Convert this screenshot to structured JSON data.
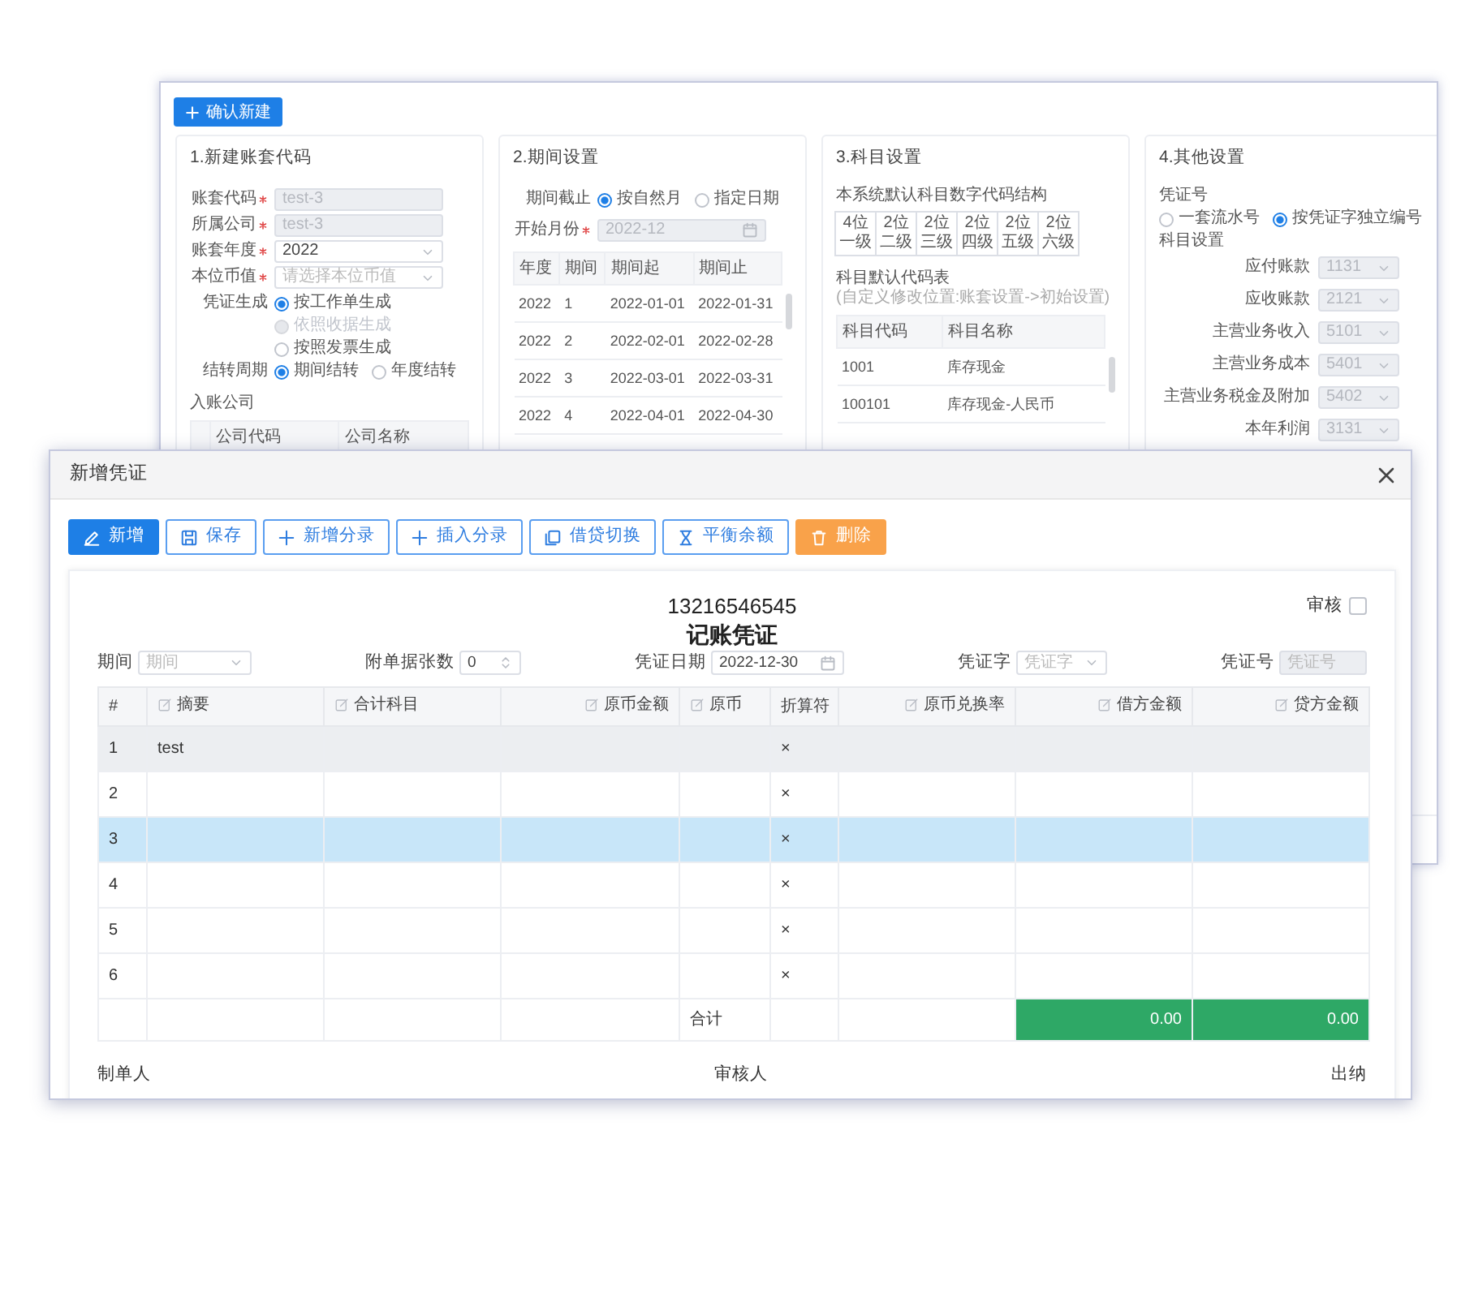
{
  "background_window": {
    "confirm_button": "确认新建",
    "account_panel": {
      "title": "1.新建账套代码",
      "fields": [
        {
          "label": "账套代码",
          "required": true,
          "kind": "input",
          "value": "test-3",
          "disabled": true
        },
        {
          "label": "所属公司",
          "required": true,
          "kind": "input",
          "value": "test-3",
          "disabled": true
        },
        {
          "label": "账套年度",
          "required": true,
          "kind": "select",
          "value": "2022",
          "disabled": false
        },
        {
          "label": "本位币值",
          "required": true,
          "kind": "select",
          "placeholder": "请选择本位币值",
          "disabled": false
        }
      ],
      "radio_groups": [
        {
          "label": "凭证生成",
          "options": [
            {
              "label": "按工作单生成",
              "selected": true,
              "disabled": false
            },
            {
              "label": "依照收据生成",
              "selected": false,
              "disabled": true
            },
            {
              "label": "按照发票生成",
              "selected": false,
              "disabled": false
            }
          ]
        },
        {
          "label": "结转周期",
          "options": [
            {
              "label": "期间结转",
              "selected": true,
              "disabled": false
            },
            {
              "label": "年度结转",
              "selected": false,
              "disabled": false
            }
          ]
        }
      ],
      "company_label": "入账公司",
      "company_columns": [
        "公司代码",
        "公司名称"
      ]
    },
    "period_panel": {
      "title": "2.期间设置",
      "radio_group": {
        "label": "期间截止",
        "options": [
          {
            "label": "按自然月",
            "selected": true
          },
          {
            "label": "指定日期",
            "selected": false
          }
        ]
      },
      "start_month": {
        "label": "开始月份",
        "required": true,
        "kind": "date",
        "value": "2022-12",
        "disabled": true
      },
      "columns": [
        "年度",
        "期间",
        "期间起",
        "期间止"
      ],
      "rows": [
        [
          "2022",
          "1",
          "2022-01-01",
          "2022-01-31"
        ],
        [
          "2022",
          "2",
          "2022-02-01",
          "2022-02-28"
        ],
        [
          "2022",
          "3",
          "2022-03-01",
          "2022-03-31"
        ],
        [
          "2022",
          "4",
          "2022-04-01",
          "2022-04-30"
        ]
      ]
    },
    "subject_panel": {
      "title": "3.科目设置",
      "structure_label": "本系统默认科目数字代码结构",
      "structure": [
        {
          "digits": "4位",
          "level": "一级"
        },
        {
          "digits": "2位",
          "level": "二级"
        },
        {
          "digits": "2位",
          "level": "三级"
        },
        {
          "digits": "2位",
          "level": "四级"
        },
        {
          "digits": "2位",
          "level": "五级"
        },
        {
          "digits": "2位",
          "level": "六级"
        }
      ],
      "table_label": "科目默认代码表",
      "hint": "(自定义修改位置:账套设置->初始设置)",
      "columns": [
        "科目代码",
        "科目名称"
      ],
      "rows": [
        [
          "1001",
          "库存现金"
        ],
        [
          "100101",
          "库存现金-人民币"
        ]
      ]
    },
    "other_panel": {
      "title": "4.其他设置",
      "voucher_label": "凭证号",
      "radio_group": {
        "options": [
          {
            "label": "一套流水号",
            "selected": false
          },
          {
            "label": "按凭证字独立编号",
            "selected": true
          }
        ]
      },
      "subject_label": "科目设置",
      "subjects": [
        {
          "label": "应付账款",
          "value": "1131"
        },
        {
          "label": "应收账款",
          "value": "2121"
        },
        {
          "label": "主营业务收入",
          "value": "5101"
        },
        {
          "label": "主营业务成本",
          "value": "5401"
        },
        {
          "label": "主营业务税金及附加",
          "value": "5402"
        },
        {
          "label": "本年利润",
          "value": "3131"
        }
      ]
    }
  },
  "dialog": {
    "title": "新增凭证",
    "toolbar": [
      {
        "label": "新增",
        "kind": "primary"
      },
      {
        "label": "保存",
        "kind": "outline"
      },
      {
        "label": "新增分录",
        "kind": "outline"
      },
      {
        "label": "插入分录",
        "kind": "outline"
      },
      {
        "label": "借贷切换",
        "kind": "outline"
      },
      {
        "label": "平衡余额",
        "kind": "outline"
      },
      {
        "label": "删除",
        "kind": "warning"
      }
    ],
    "voucher": {
      "number": "13216546545",
      "title": "记账凭证",
      "audit": {
        "label": "审核",
        "checked": false
      },
      "fields": [
        {
          "label": "期间",
          "kind": "select",
          "placeholder": "期间",
          "disabled": false
        },
        {
          "label": "附单据张数",
          "kind": "number",
          "value": "0",
          "disabled": false
        },
        {
          "label": "凭证日期",
          "kind": "date",
          "value": "2022-12-30",
          "disabled": false
        },
        {
          "label": "凭证字",
          "kind": "select",
          "placeholder": "凭证字",
          "disabled": false
        },
        {
          "label": "凭证号",
          "kind": "input",
          "placeholder": "凭证号",
          "disabled": true
        }
      ],
      "columns": [
        {
          "label": "#",
          "editable": false,
          "kind": "text"
        },
        {
          "label": "摘要",
          "editable": true,
          "kind": "text"
        },
        {
          "label": "合计科目",
          "editable": true,
          "kind": "text"
        },
        {
          "label": "原币金额",
          "editable": true,
          "kind": "amount"
        },
        {
          "label": "原币",
          "editable": true,
          "kind": "text"
        },
        {
          "label": "折算符",
          "editable": false,
          "kind": "text"
        },
        {
          "label": "原币兑换率",
          "editable": true,
          "kind": "amount"
        },
        {
          "label": "借方金额",
          "editable": true,
          "kind": "amount"
        },
        {
          "label": "贷方金额",
          "editable": true,
          "kind": "amount"
        }
      ],
      "rows": [
        {
          "index": "1",
          "summary": "test",
          "operator": "×",
          "selected": false,
          "hovered": true
        },
        {
          "index": "2",
          "operator": "×",
          "selected": false,
          "hovered": false
        },
        {
          "index": "3",
          "operator": "×",
          "selected": true,
          "hovered": false
        },
        {
          "index": "4",
          "operator": "×",
          "selected": false,
          "hovered": false
        },
        {
          "index": "5",
          "operator": "×",
          "selected": false,
          "hovered": false
        },
        {
          "index": "6",
          "operator": "×",
          "selected": false,
          "hovered": false
        }
      ],
      "totals": {
        "label": "合计",
        "debit": "0.00",
        "credit": "0.00"
      },
      "signatures": [
        "制单人",
        "审核人",
        "出纳"
      ]
    }
  }
}
